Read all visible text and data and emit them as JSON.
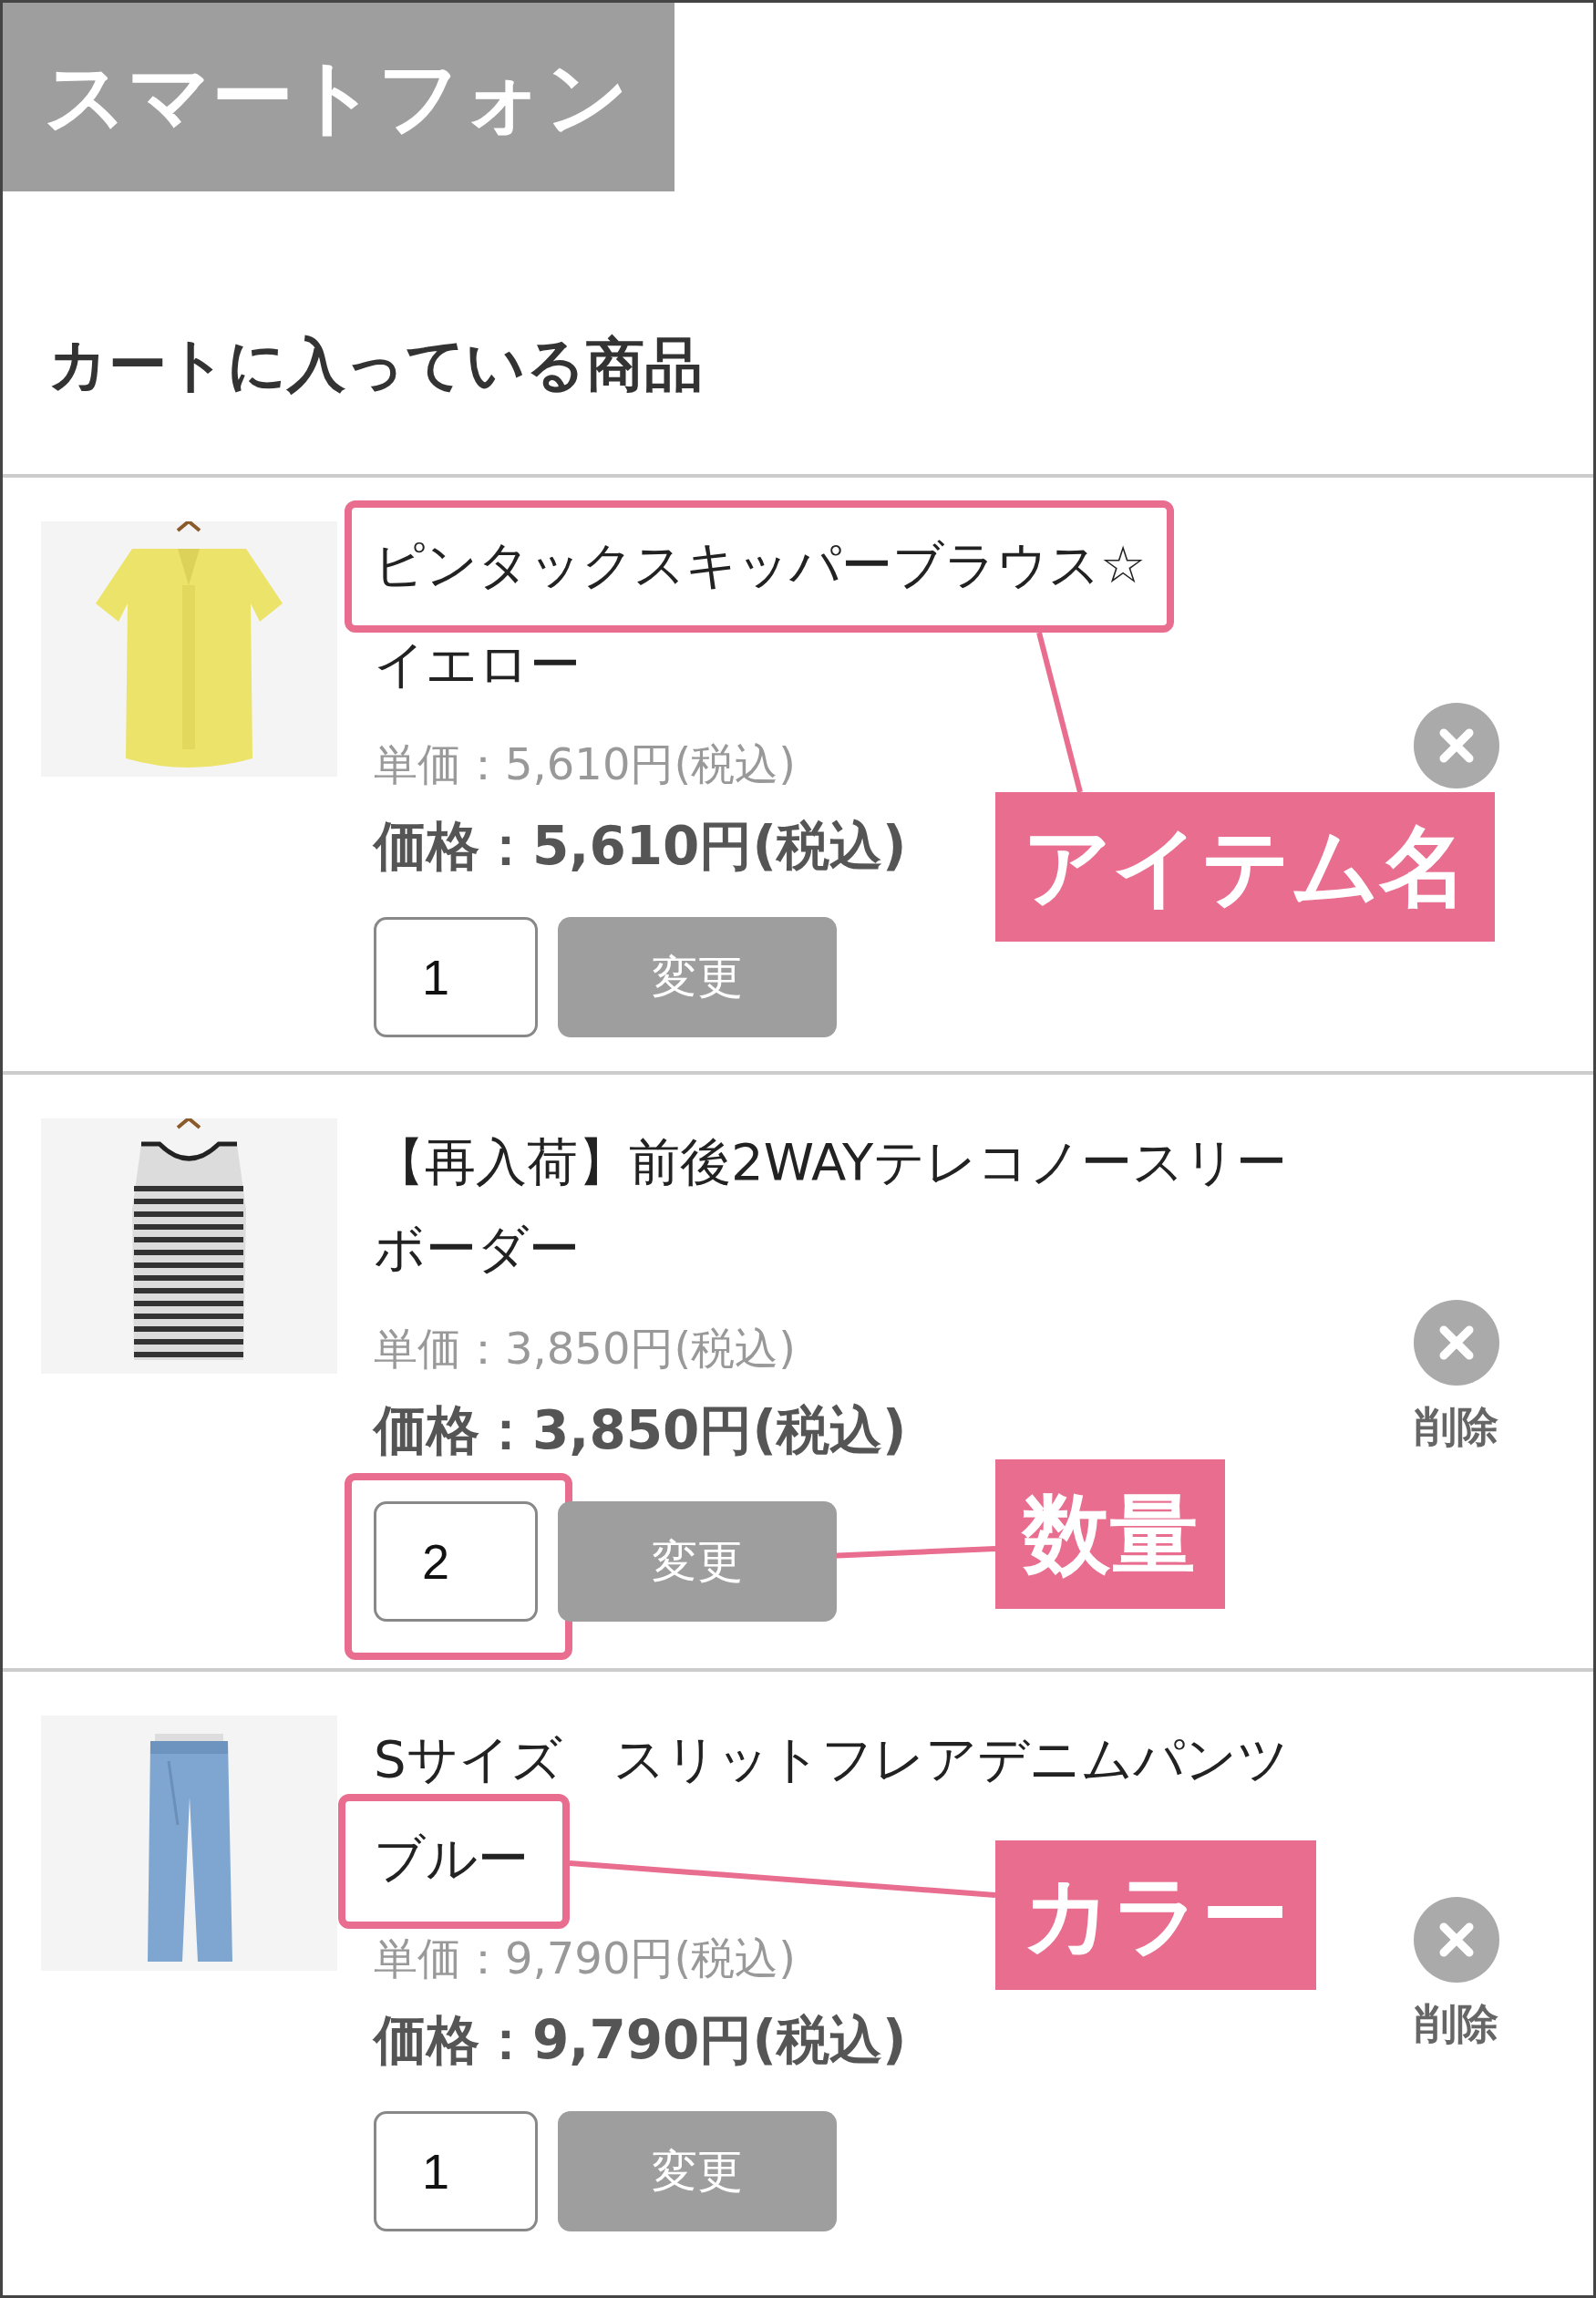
{
  "badge": "スマートフォン",
  "heading": "カートに入っている商品",
  "items": [
    {
      "name": "ピンタックスキッパーブラウス☆",
      "color_name": "イエロー",
      "unit_price": "単価：5,610円(税込)",
      "price": "価格：5,610円(税込)",
      "quantity": "1",
      "change_button": "変更",
      "callout": "アイテム名"
    },
    {
      "name": "【再入荷】前後2WAYテレコノースリーボーダー",
      "unit_price": "単価：3,850円(税込)",
      "price": "価格：3,850円(税込)",
      "quantity": "2",
      "change_button": "変更",
      "delete_label": "削除",
      "callout": "数量"
    },
    {
      "name": "Sサイズ　スリットフレアデニムパンツ",
      "color_name": "ブルー",
      "unit_price": "単価：9,790円(税込)",
      "price": "価格：9,790円(税込)",
      "quantity": "1",
      "change_button": "変更",
      "delete_label": "削除",
      "callout": "カラー"
    }
  ]
}
